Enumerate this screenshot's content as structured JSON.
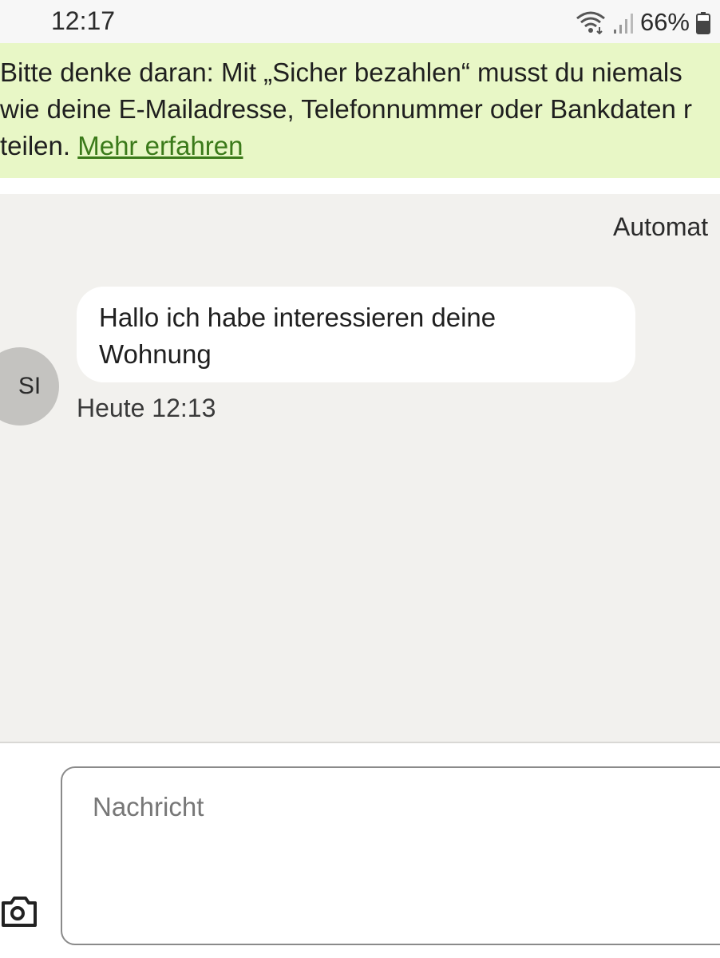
{
  "status_bar": {
    "time": "12:17",
    "battery_percent": "66%",
    "icons": [
      "wifi-icon",
      "signal-icon",
      "battery-icon"
    ]
  },
  "banner": {
    "line1": "Bitte denke daran: Mit „Sicher bezahlen“ musst du niemals",
    "line2": "wie deine E-Mailadresse, Telefonnummer oder Bankdaten r",
    "line3_prefix": "teilen. ",
    "link_text": "Mehr erfahren",
    "link_color": "#3b7a1a",
    "background": "#e8f7c6"
  },
  "chat": {
    "auto_label": "Automat",
    "background": "#f2f1ee",
    "messages": [
      {
        "avatar_initials": "SI",
        "line1": "Hallo ich habe interessieren deine",
        "line2": "Wohnung",
        "time": "Heute 12:13"
      }
    ]
  },
  "composer": {
    "placeholder": "Nachricht",
    "value": "",
    "camera_icon": "camera-icon"
  }
}
